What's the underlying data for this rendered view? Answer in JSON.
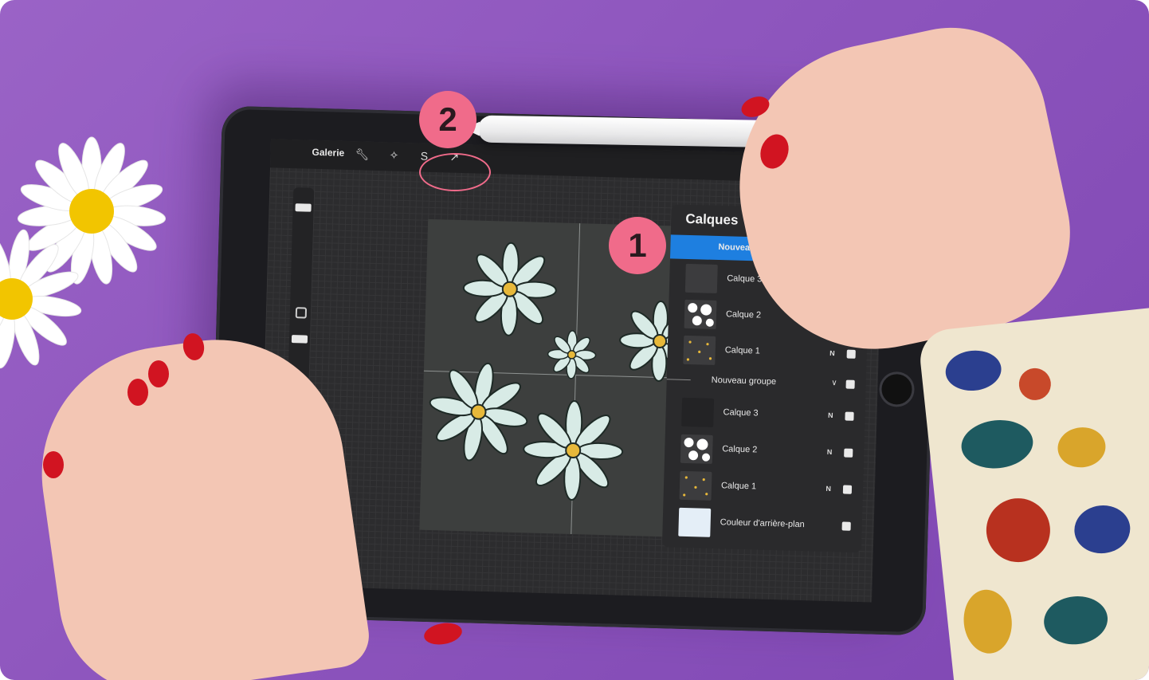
{
  "toolbar": {
    "gallery": "Galerie"
  },
  "layers_panel": {
    "title": "Calques",
    "rows": [
      {
        "label": "Nouveau groupe",
        "type": "group",
        "selected": true
      },
      {
        "label": "Calque 3",
        "mode": "N",
        "type": "layer"
      },
      {
        "label": "Calque 2",
        "mode": "N",
        "type": "layer"
      },
      {
        "label": "Calque 1",
        "mode": "N",
        "type": "layer"
      },
      {
        "label": "Nouveau groupe",
        "type": "group",
        "selected": false
      },
      {
        "label": "Calque 3",
        "mode": "N",
        "type": "layer"
      },
      {
        "label": "Calque 2",
        "mode": "N",
        "type": "layer"
      },
      {
        "label": "Calque 1",
        "mode": "N",
        "type": "layer"
      },
      {
        "label": "Couleur d'arrière-plan",
        "type": "background"
      }
    ]
  },
  "annotations": {
    "badge1": "1",
    "badge2": "2"
  },
  "colors": {
    "background": "#8d55bd",
    "accent_badge": "#f06b8a",
    "selection_blue": "#1e7fe0",
    "petal": "#d8ebe6",
    "center": "#e7b83a"
  }
}
